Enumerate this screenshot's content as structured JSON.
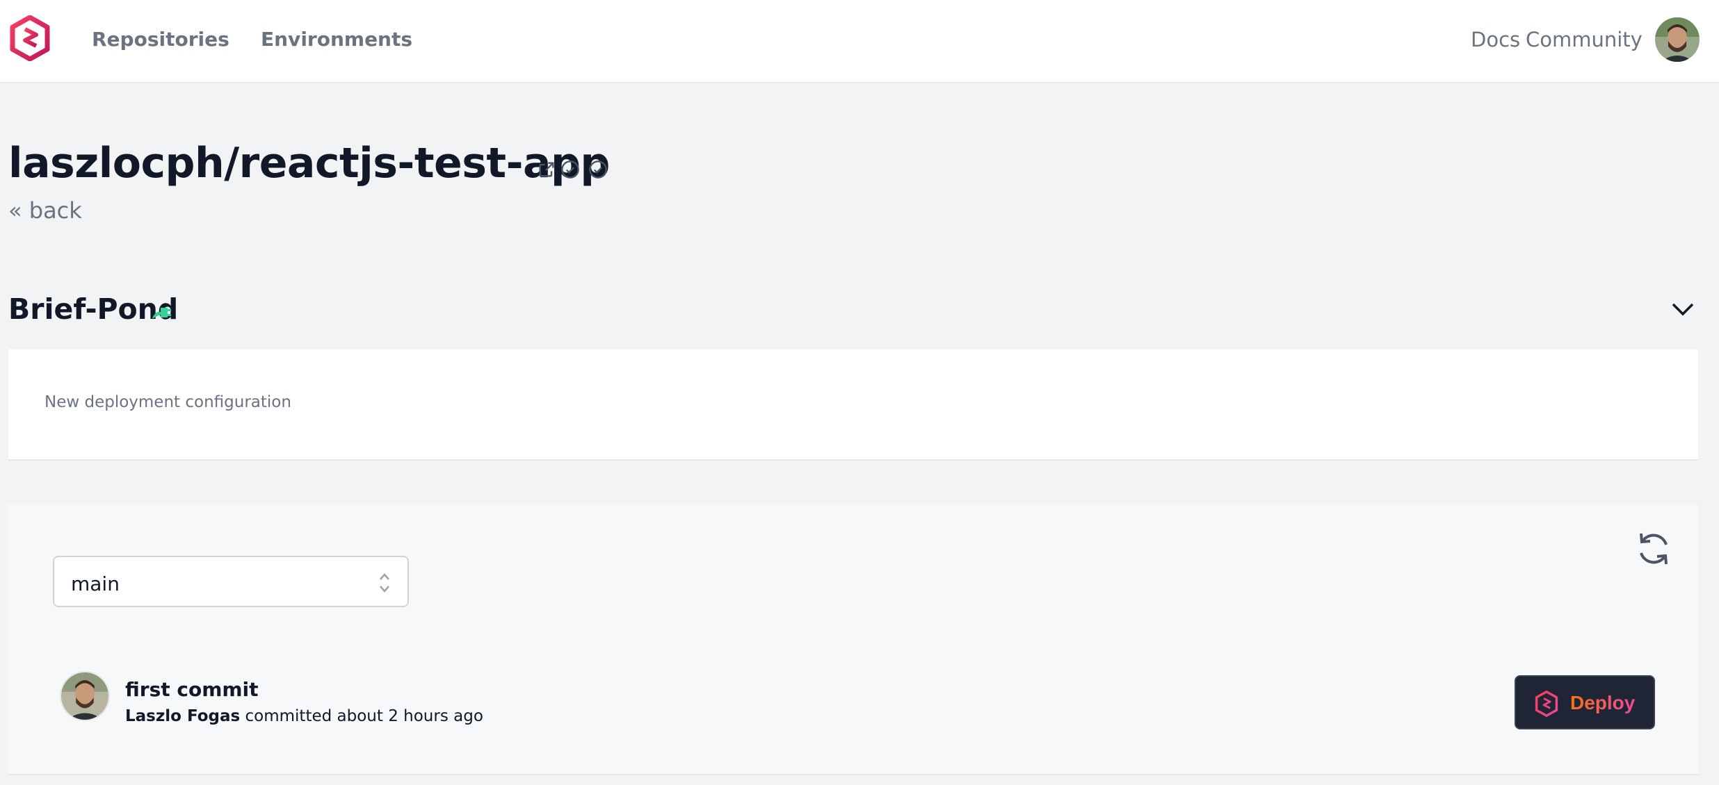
{
  "nav": {
    "links": [
      "Repositories",
      "Environments"
    ],
    "right_links": [
      "Docs",
      "Community"
    ]
  },
  "repo": {
    "title": "laszlocph/reactjs-test-app",
    "back": "« back"
  },
  "environment": {
    "name": "Brief-Pond",
    "config_text": "New deployment configuration"
  },
  "deploy": {
    "branch": "main",
    "commit_message": "first commit",
    "author": "Laszlo Fogas",
    "committed_word": "committed",
    "time": "about 2 hours ago",
    "button_label": "Deploy"
  },
  "icons": {
    "logo": "gimlet-logo-icon",
    "external_link": "external-link-icon",
    "check_1": "check-circle-icon",
    "check_2": "check-circle-icon",
    "plug": "plug-icon",
    "chevron": "chevron-down-icon",
    "refresh": "refresh-icon",
    "select_arrows": "selector-icon"
  },
  "colors": {
    "accent_pink": "#e11d48",
    "plug_green": "#34d399",
    "deploy_bg": "#1f2535",
    "deploy_text_from": "#f97316",
    "deploy_text_to": "#ec4899"
  }
}
